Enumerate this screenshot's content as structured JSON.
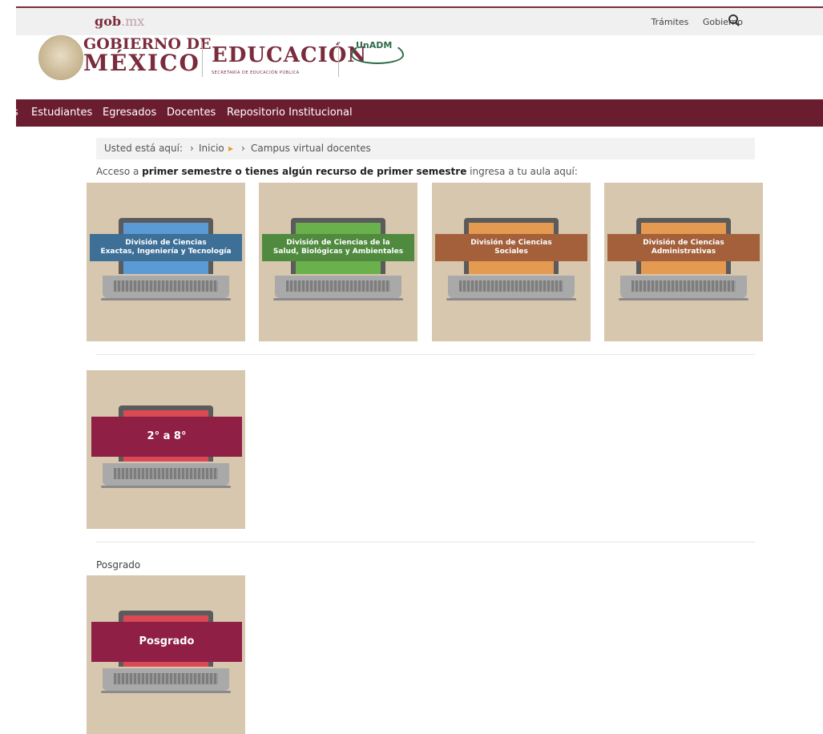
{
  "topbar": {
    "brand": "gob",
    "brand_suffix": ".mx",
    "links": [
      "Trámites",
      "Gobierno"
    ]
  },
  "logos": {
    "gobierno_line1": "GOBIERNO DE",
    "gobierno_line2": "MÉXICO",
    "educacion": "EDUCACIÓN",
    "educacion_sub": "SECRETARÍA DE EDUCACIÓN PÚBLICA",
    "unadm": "UnADM"
  },
  "mainnav": {
    "items": [
      "s",
      "Estudiantes",
      "Egresados",
      "Docentes",
      "Repositorio Institucional"
    ]
  },
  "breadcrumb": {
    "prefix": "Usted está aquí:",
    "items": [
      "Inicio",
      "Campus virtual docentes"
    ]
  },
  "acceso": {
    "text1": "Acceso a ",
    "bold": "primer semestre o tienes algún recurso de primer semestre",
    "text2": " ingresa a tu aula aquí:"
  },
  "divisions": [
    {
      "line1": "División de Ciencias",
      "line2": "Exactas, Ingeniería y Tecnología",
      "band_color": "#3d6f97",
      "screen_color": "#5b9bd5"
    },
    {
      "line1": "División de Ciencias de la",
      "line2": "Salud, Biológicas y Ambientales",
      "band_color": "#4f8a3f",
      "screen_color": "#6ab04c"
    },
    {
      "line1": "División de Ciencias",
      "line2": "Sociales",
      "band_color": "#a3603a",
      "screen_color": "#e59a52"
    },
    {
      "line1": "División de Ciencias",
      "line2": "Administrativas",
      "band_color": "#a3603a",
      "screen_color": "#e59a52"
    }
  ],
  "semestres": {
    "label": "2° a 8°",
    "band_color": "#8f1f44",
    "screen_color": "#d94a55"
  },
  "posgrado": {
    "section_label": "Posgrado",
    "card_label": "Posgrado",
    "band_color": "#8f1f44",
    "screen_color": "#d94a55"
  }
}
